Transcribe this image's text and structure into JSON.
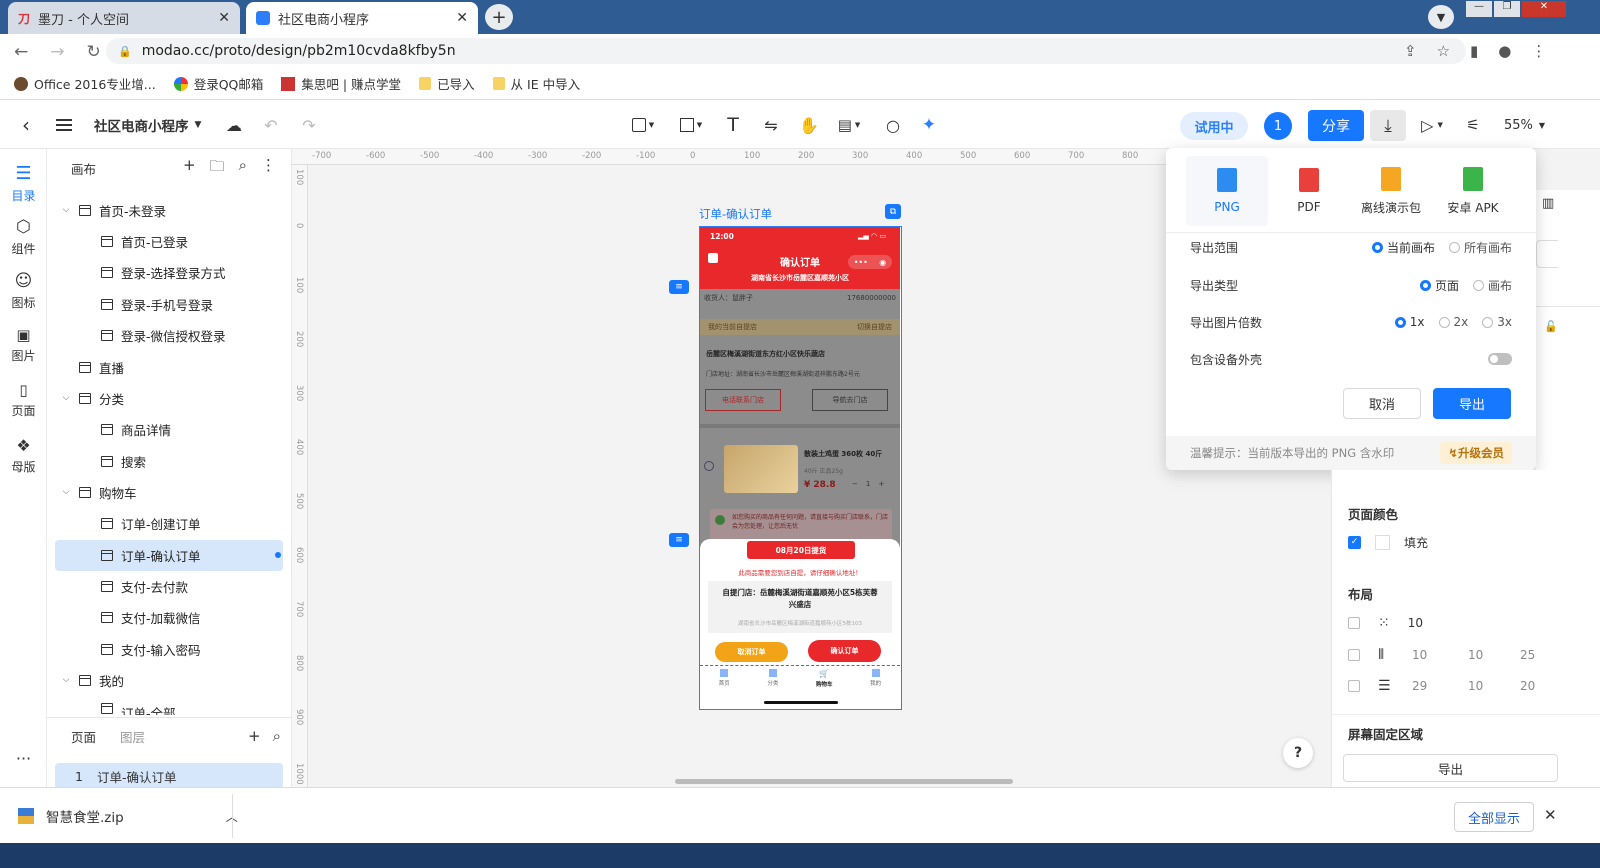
{
  "browser": {
    "tabs": [
      {
        "title": "墨刀 - 个人空间",
        "active": false
      },
      {
        "title": "社区电商小程序",
        "active": true
      }
    ],
    "new_tab": "+",
    "url": "modao.cc/proto/design/pb2m10cvda8kfby5n",
    "bookmarks": [
      "Office 2016专业增...",
      "登录QQ邮箱",
      "集思吧 | 赚点学堂",
      "已导入",
      "从 IE 中导入"
    ]
  },
  "toolbar": {
    "project_name": "社区电商小程序",
    "trial_label": "试用中",
    "collab_count": "1",
    "share_label": "分享",
    "zoom": "55%"
  },
  "rail": {
    "items": [
      "目录",
      "组件",
      "图标",
      "图片",
      "页面",
      "母版"
    ],
    "more": "···"
  },
  "tree": {
    "header": "画布",
    "nodes": [
      "首页-未登录",
      "首页-已登录",
      "登录-选择登录方式",
      "登录-手机号登录",
      "登录-微信授权登录",
      "直播",
      "分类",
      "商品详情",
      "搜索",
      "购物车",
      "订单-创建订单",
      "订单-确认订单",
      "支付-去付款",
      "支付-加载微信",
      "支付-输入密码",
      "我的",
      "订单-全部"
    ],
    "bottom_tabs": [
      "页面",
      "图层"
    ],
    "page_item_index": "1",
    "page_item_label": "订单-确认订单"
  },
  "canvas": {
    "ruler_h": [
      "-700",
      "-600",
      "-500",
      "-400",
      "-300",
      "-200",
      "-100",
      "0",
      "100",
      "200",
      "300",
      "400",
      "500",
      "600",
      "700",
      "800"
    ],
    "ruler_v": [
      "100",
      "0",
      "100",
      "200",
      "300",
      "400",
      "500",
      "600",
      "700",
      "800",
      "900",
      "1000"
    ],
    "frame_label": "订单-确认订单",
    "help": "?"
  },
  "phone": {
    "time": "12:00",
    "title": "确认订单",
    "subtitle": "湖南省长沙市岳麓区嘉顺苑小区",
    "receiver": "收货人：鼠胖子",
    "phone_no": "17680000000",
    "my_store": "我的当前自提店",
    "switch_store": "切换自提店",
    "store_name": "岳麓区梅溪湖街道东方红小区快乐蔬店",
    "store_addr": "门店地址：湖南省长沙市岳麓区梅溪湖街道梓鹏东路2号元",
    "call_btn": "电话联系门店",
    "nav_btn": "导航去门店",
    "product_name": "散装土鸡蛋 360枚 40斤",
    "product_spec": "40斤 正品25g",
    "price": "28.8",
    "qty": "1",
    "notice": "如您购买的商品有任何问题，请直接与购买门店联系，门店会为您处理，让您后无忧",
    "popup_date": "08月20日提货",
    "popup_warning": "此商品需要您到店自提，请仔细确认地址！",
    "popup_store": "自提门店：岳麓梅溪湖街道嘉顺苑小区5栋芙蓉兴盛店",
    "popup_addr": "湖南省长沙市岳麓区梅溪湖街道嘉顺苑小区5栋103",
    "cancel_order": "取消订单",
    "confirm_order": "确认订单",
    "nav": [
      "首页",
      "分类",
      "购物车",
      "我的"
    ]
  },
  "export": {
    "formats": [
      "PNG",
      "PDF",
      "离线演示包",
      "安卓 APK"
    ],
    "range_label": "导出范围",
    "range_opts": [
      "当前画布",
      "所有画布"
    ],
    "type_label": "导出类型",
    "type_opts": [
      "页面",
      "画布"
    ],
    "scale_label": "导出图片倍数",
    "scale_opts": [
      "1x",
      "2x",
      "3x"
    ],
    "device_label": "包含设备外壳",
    "cancel": "取消",
    "confirm": "导出",
    "hint": "温馨提示：当前版本导出的 PNG 含水印",
    "upgrade": "升级会员",
    "accent": "#1677ff"
  },
  "rpanel": {
    "page_color": "页面颜色",
    "fill": "填充",
    "layout": "布局",
    "grid_rows": [
      {
        "v1": "10",
        "v2": "",
        "v3": ""
      },
      {
        "v1": "10",
        "v2": "10",
        "v3": "25"
      },
      {
        "v1": "29",
        "v2": "10",
        "v3": "20"
      }
    ],
    "fixed_area": "屏幕固定区域",
    "export_btn": "导出"
  },
  "download": {
    "file": "智慧食堂.zip",
    "show_all": "全部显示"
  }
}
